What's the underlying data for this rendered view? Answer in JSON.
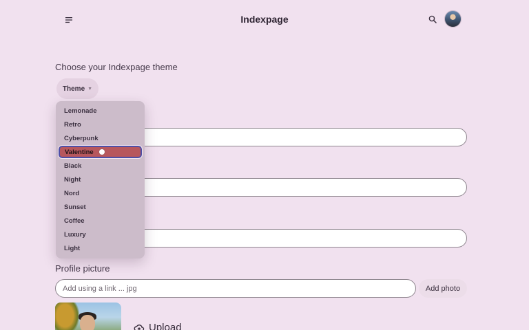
{
  "header": {
    "title": "Indexpage",
    "menu_icon": "hamburger-menu-icon",
    "search_icon": "search-icon"
  },
  "theme_section": {
    "title": "Choose your Indexpage theme",
    "button_label": "Theme",
    "options": [
      "Lemonade",
      "Retro",
      "Cyberpunk",
      "Valentine",
      "Black",
      "Night",
      "Nord",
      "Sunset",
      "Coffee",
      "Luxury",
      "Light"
    ],
    "active_option": "Valentine"
  },
  "profile_picture": {
    "label": "Profile picture",
    "input_placeholder": "Add using a link ... jpg",
    "add_photo_label": "Add photo",
    "upload_label": "Upload"
  },
  "colors": {
    "background": "#f1e1ef",
    "dropdown": "#ccbcca",
    "active_item": "#b7575d",
    "focus_ring": "#4e4fa6"
  }
}
